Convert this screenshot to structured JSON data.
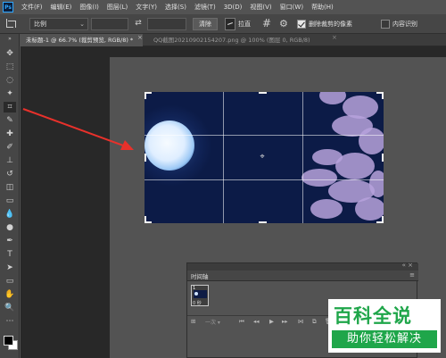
{
  "app": {
    "logo": "Ps",
    "menu": [
      "文件(F)",
      "编辑(E)",
      "图像(I)",
      "图层(L)",
      "文字(Y)",
      "选择(S)",
      "滤镜(T)",
      "3D(D)",
      "视图(V)",
      "窗口(W)",
      "帮助(H)"
    ]
  },
  "options": {
    "ratio_value": "比例",
    "clear_label": "清除",
    "straighten_label": "拉直",
    "delete_pixels_label": "删除裁剪的像素",
    "delete_pixels_checked": true,
    "content_aware_label": "内容识别",
    "content_aware_checked": false
  },
  "tabs": [
    {
      "label": "未标题-1 @ 66.7% (裁剪预览, RGB/8) *",
      "active": true
    },
    {
      "label": "QQ截图20210902154207.png @ 100% (图层 0, RGB/8)",
      "active": false
    }
  ],
  "timeline": {
    "title": "时间轴",
    "frame_index": "1",
    "frame_delay": "0 秒",
    "loop_option": "一次"
  },
  "watermark": {
    "title": "百科全说",
    "subtitle": "助你轻松解决"
  },
  "colors": {
    "foreground": "#000000",
    "background": "#ffffff",
    "arrow": "#e8312b",
    "watermark_green": "#1fa64a"
  }
}
